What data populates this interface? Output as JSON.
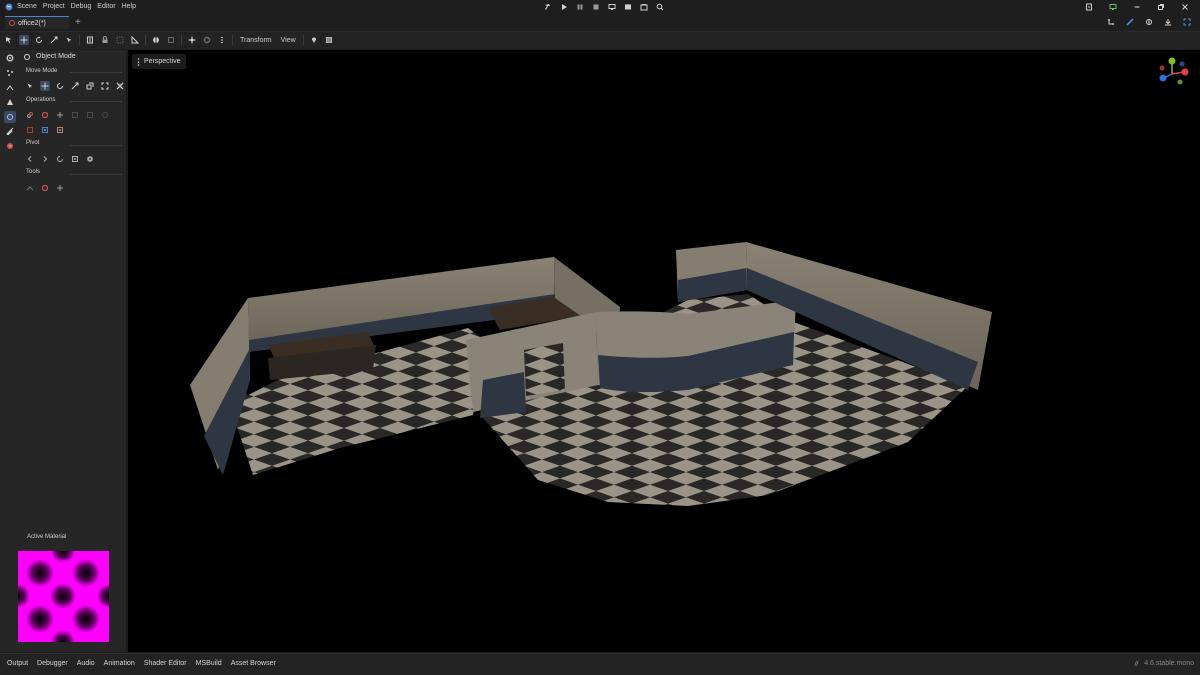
{
  "menu": {
    "items": [
      "Scene",
      "Project",
      "Debug",
      "Editor",
      "Help"
    ]
  },
  "tabs": {
    "active_tab": "office2(*)",
    "add_label": "+"
  },
  "toolbar": {
    "transform_label": "Transform",
    "view_label": "View"
  },
  "panel": {
    "mode_label": "Object Mode",
    "move_mode_label": "Move Mode",
    "operations_label": "Operations",
    "pivot_label": "Pivot",
    "tools_label": "Tools",
    "active_material_label": "Active Material"
  },
  "viewport": {
    "perspective_label": "Perspective"
  },
  "bottom_tabs": [
    "Output",
    "Debugger",
    "Audio",
    "Animation",
    "Shader Editor",
    "MSBuild",
    "Asset Browser"
  ],
  "status": {
    "version": "4.6.stable.mono"
  },
  "colors": {
    "accent": "#4a86d6",
    "material_pink": "#ff00ff",
    "gizmo_x": "#e04050",
    "gizmo_y": "#80c020",
    "gizmo_z": "#3070e0"
  },
  "icons": {
    "run_bar": [
      "hammer-icon",
      "play-icon",
      "pause-icon",
      "stop-icon",
      "remote-debug-icon",
      "movie-icon",
      "layout-icon",
      "search-icon"
    ]
  }
}
